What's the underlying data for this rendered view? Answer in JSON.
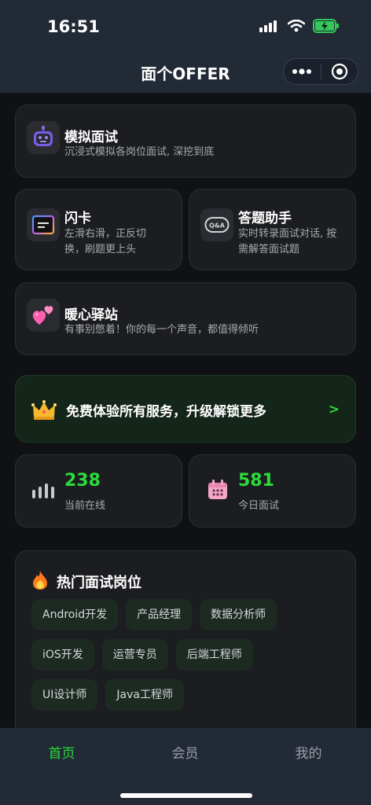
{
  "status": {
    "time": "16:51"
  },
  "nav": {
    "title": "面个OFFER"
  },
  "features": {
    "mock": {
      "title": "模拟面试",
      "desc": "沉浸式模拟各岗位面试, 深挖到底",
      "icon": "robot-icon"
    },
    "flash": {
      "title": "闪卡",
      "desc_line1": "左滑右滑，正反切",
      "desc_line2": "换，刷题更上头",
      "icon": "flashcard-icon"
    },
    "assist": {
      "title": "答题助手",
      "desc_line1": "实时转录面试对话, 按",
      "desc_line2": "需解答面试题",
      "icon": "qa-icon"
    },
    "warm": {
      "title": "暖心驿站",
      "desc": "有事别憋着！你的每一个声音，都值得倾听",
      "icon": "hearts-icon"
    }
  },
  "promo": {
    "text": "免费体验所有服务，升级解锁更多",
    "arrow": ">",
    "icon": "crown-icon"
  },
  "stats": {
    "online": {
      "value": "238",
      "label": "当前在线",
      "icon": "signal-bars-icon"
    },
    "today": {
      "value": "581",
      "label": "今日面试",
      "icon": "calendar-icon"
    }
  },
  "hot": {
    "title": "热门面试岗位",
    "icon": "fire-icon",
    "rows": [
      [
        "Android开发",
        "产品经理",
        "数据分析师"
      ],
      [
        "iOS开发",
        "运营专员",
        "后端工程师"
      ],
      [
        "UI设计师",
        "Java工程师"
      ]
    ]
  },
  "tabs": {
    "home": "首页",
    "member": "会员",
    "mine": "我的"
  },
  "colors": {
    "accent": "#2bdc3a",
    "bar": "#222a36",
    "card": "#1c1d21"
  }
}
